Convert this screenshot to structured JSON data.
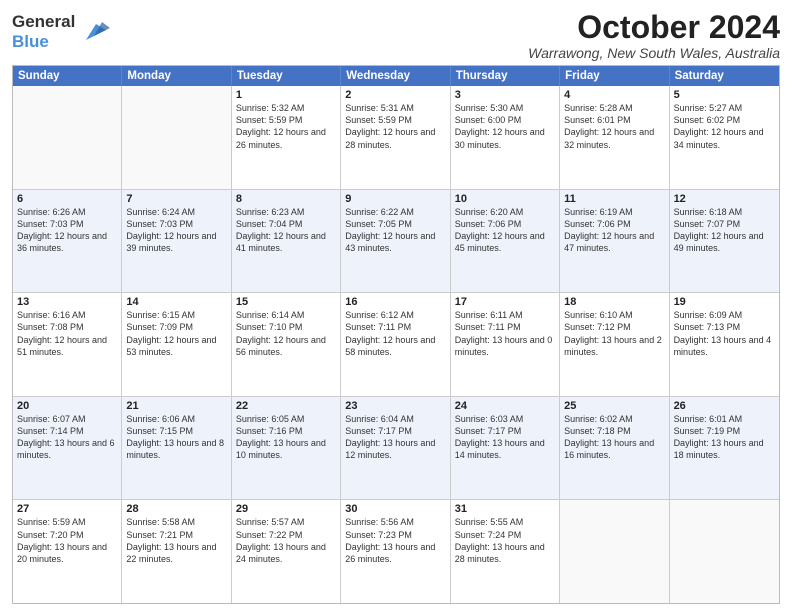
{
  "logo": {
    "line1": "General",
    "line2": "Blue"
  },
  "title": "October 2024",
  "location": "Warrawong, New South Wales, Australia",
  "days_of_week": [
    "Sunday",
    "Monday",
    "Tuesday",
    "Wednesday",
    "Thursday",
    "Friday",
    "Saturday"
  ],
  "rows": [
    [
      {
        "day": "",
        "info": ""
      },
      {
        "day": "",
        "info": ""
      },
      {
        "day": "1",
        "info": "Sunrise: 5:32 AM\nSunset: 5:59 PM\nDaylight: 12 hours and 26 minutes."
      },
      {
        "day": "2",
        "info": "Sunrise: 5:31 AM\nSunset: 5:59 PM\nDaylight: 12 hours and 28 minutes."
      },
      {
        "day": "3",
        "info": "Sunrise: 5:30 AM\nSunset: 6:00 PM\nDaylight: 12 hours and 30 minutes."
      },
      {
        "day": "4",
        "info": "Sunrise: 5:28 AM\nSunset: 6:01 PM\nDaylight: 12 hours and 32 minutes."
      },
      {
        "day": "5",
        "info": "Sunrise: 5:27 AM\nSunset: 6:02 PM\nDaylight: 12 hours and 34 minutes."
      }
    ],
    [
      {
        "day": "6",
        "info": "Sunrise: 6:26 AM\nSunset: 7:03 PM\nDaylight: 12 hours and 36 minutes."
      },
      {
        "day": "7",
        "info": "Sunrise: 6:24 AM\nSunset: 7:03 PM\nDaylight: 12 hours and 39 minutes."
      },
      {
        "day": "8",
        "info": "Sunrise: 6:23 AM\nSunset: 7:04 PM\nDaylight: 12 hours and 41 minutes."
      },
      {
        "day": "9",
        "info": "Sunrise: 6:22 AM\nSunset: 7:05 PM\nDaylight: 12 hours and 43 minutes."
      },
      {
        "day": "10",
        "info": "Sunrise: 6:20 AM\nSunset: 7:06 PM\nDaylight: 12 hours and 45 minutes."
      },
      {
        "day": "11",
        "info": "Sunrise: 6:19 AM\nSunset: 7:06 PM\nDaylight: 12 hours and 47 minutes."
      },
      {
        "day": "12",
        "info": "Sunrise: 6:18 AM\nSunset: 7:07 PM\nDaylight: 12 hours and 49 minutes."
      }
    ],
    [
      {
        "day": "13",
        "info": "Sunrise: 6:16 AM\nSunset: 7:08 PM\nDaylight: 12 hours and 51 minutes."
      },
      {
        "day": "14",
        "info": "Sunrise: 6:15 AM\nSunset: 7:09 PM\nDaylight: 12 hours and 53 minutes."
      },
      {
        "day": "15",
        "info": "Sunrise: 6:14 AM\nSunset: 7:10 PM\nDaylight: 12 hours and 56 minutes."
      },
      {
        "day": "16",
        "info": "Sunrise: 6:12 AM\nSunset: 7:11 PM\nDaylight: 12 hours and 58 minutes."
      },
      {
        "day": "17",
        "info": "Sunrise: 6:11 AM\nSunset: 7:11 PM\nDaylight: 13 hours and 0 minutes."
      },
      {
        "day": "18",
        "info": "Sunrise: 6:10 AM\nSunset: 7:12 PM\nDaylight: 13 hours and 2 minutes."
      },
      {
        "day": "19",
        "info": "Sunrise: 6:09 AM\nSunset: 7:13 PM\nDaylight: 13 hours and 4 minutes."
      }
    ],
    [
      {
        "day": "20",
        "info": "Sunrise: 6:07 AM\nSunset: 7:14 PM\nDaylight: 13 hours and 6 minutes."
      },
      {
        "day": "21",
        "info": "Sunrise: 6:06 AM\nSunset: 7:15 PM\nDaylight: 13 hours and 8 minutes."
      },
      {
        "day": "22",
        "info": "Sunrise: 6:05 AM\nSunset: 7:16 PM\nDaylight: 13 hours and 10 minutes."
      },
      {
        "day": "23",
        "info": "Sunrise: 6:04 AM\nSunset: 7:17 PM\nDaylight: 13 hours and 12 minutes."
      },
      {
        "day": "24",
        "info": "Sunrise: 6:03 AM\nSunset: 7:17 PM\nDaylight: 13 hours and 14 minutes."
      },
      {
        "day": "25",
        "info": "Sunrise: 6:02 AM\nSunset: 7:18 PM\nDaylight: 13 hours and 16 minutes."
      },
      {
        "day": "26",
        "info": "Sunrise: 6:01 AM\nSunset: 7:19 PM\nDaylight: 13 hours and 18 minutes."
      }
    ],
    [
      {
        "day": "27",
        "info": "Sunrise: 5:59 AM\nSunset: 7:20 PM\nDaylight: 13 hours and 20 minutes."
      },
      {
        "day": "28",
        "info": "Sunrise: 5:58 AM\nSunset: 7:21 PM\nDaylight: 13 hours and 22 minutes."
      },
      {
        "day": "29",
        "info": "Sunrise: 5:57 AM\nSunset: 7:22 PM\nDaylight: 13 hours and 24 minutes."
      },
      {
        "day": "30",
        "info": "Sunrise: 5:56 AM\nSunset: 7:23 PM\nDaylight: 13 hours and 26 minutes."
      },
      {
        "day": "31",
        "info": "Sunrise: 5:55 AM\nSunset: 7:24 PM\nDaylight: 13 hours and 28 minutes."
      },
      {
        "day": "",
        "info": ""
      },
      {
        "day": "",
        "info": ""
      }
    ]
  ]
}
